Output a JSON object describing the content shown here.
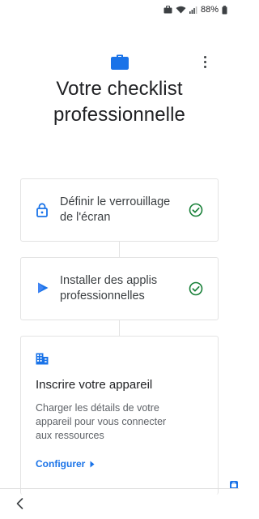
{
  "status_bar": {
    "battery_percent": "88%",
    "icons": [
      "briefcase-icon",
      "wifi-icon",
      "signal-icon",
      "battery-icon"
    ]
  },
  "header": {
    "icon": "briefcase-icon",
    "title_line1": "Votre checklist",
    "title_line2": "professionnelle",
    "menu_icon": "more-vert-icon"
  },
  "steps": [
    {
      "icon": "lock-icon",
      "label_line1": "Définir le verrouillage",
      "label_line2": "de l'écran",
      "status": "done",
      "status_icon": "check-circle-icon"
    },
    {
      "icon": "play-arrow-icon",
      "label_line1": "Installer des applis",
      "label_line2": "professionnelles",
      "status": "done",
      "status_icon": "check-circle-icon"
    },
    {
      "icon": "building-icon",
      "title": "Inscrire votre appareil",
      "description_line1": "Charger les détails de votre",
      "description_line2": "appareil pour vous connecter",
      "description_line3": "aux ressources",
      "action_label": "Configurer",
      "action_icon": "chevron-right-icon"
    }
  ],
  "colors": {
    "accent": "#1a73e8",
    "check": "#188038",
    "text_primary": "#202124",
    "text_secondary": "#5f6368",
    "border": "#e3e3e3"
  },
  "navigation": {
    "back_icon": "back-arrow-icon"
  }
}
